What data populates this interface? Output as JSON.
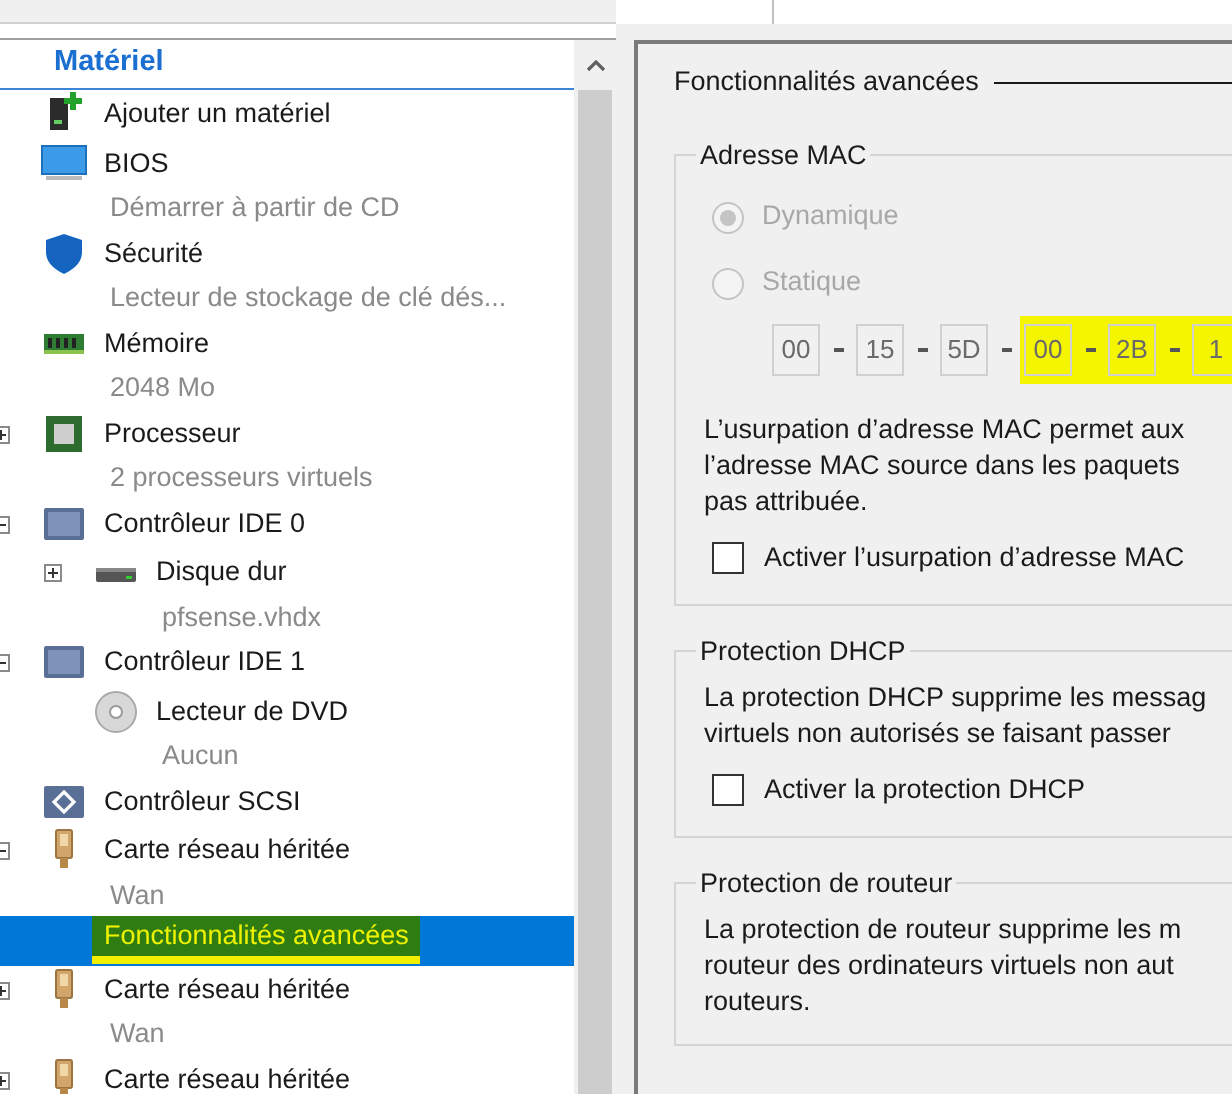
{
  "sidebar": {
    "header": "Matériel",
    "items": [
      {
        "kind": "add-hardware",
        "label": "Ajouter un matériel",
        "selected": false
      },
      {
        "kind": "bios",
        "label": "BIOS",
        "detail": "Démarrer à partir de CD",
        "selected": false
      },
      {
        "kind": "security",
        "label": "Sécurité",
        "detail": "Lecteur de stockage de clé dés...",
        "selected": false
      },
      {
        "kind": "memory",
        "label": "Mémoire",
        "detail": "2048 Mo",
        "selected": false
      },
      {
        "kind": "processor",
        "label": "Processeur",
        "detail": "2 processeurs virtuels",
        "expanded": false,
        "selected": false
      },
      {
        "kind": "ide",
        "label": "Contrôleur IDE 0",
        "expanded": true,
        "selected": false,
        "children": [
          {
            "kind": "disk",
            "label": "Disque dur",
            "detail": "pfsense.vhdx",
            "expanded": false,
            "selected": false
          }
        ]
      },
      {
        "kind": "ide",
        "label": "Contrôleur IDE 1",
        "expanded": true,
        "selected": false,
        "children": [
          {
            "kind": "dvd",
            "label": "Lecteur de DVD",
            "detail": "Aucun",
            "selected": false
          }
        ]
      },
      {
        "kind": "scsi",
        "label": "Contrôleur SCSI",
        "selected": false
      },
      {
        "kind": "network",
        "label": "Carte réseau héritée",
        "detail": "Wan",
        "expanded": true,
        "selected": false,
        "children": [
          {
            "kind": "feature",
            "label": "Fonctionnalités avancées",
            "selected": true,
            "highlighted": true
          }
        ]
      },
      {
        "kind": "network",
        "label": "Carte réseau héritée",
        "detail": "Wan",
        "expanded": false,
        "selected": false
      },
      {
        "kind": "network",
        "label": "Carte réseau héritée",
        "expanded": false,
        "selected": false
      }
    ]
  },
  "settings": {
    "title": "Fonctionnalités avancées",
    "groups": [
      {
        "kind": "mac",
        "title": "Adresse MAC",
        "radios": [
          {
            "label": "Dynamique",
            "selected": true,
            "disabled": true
          },
          {
            "label": "Statique",
            "selected": false,
            "disabled": true
          }
        ],
        "mac_fields": [
          {
            "value": "00",
            "highlighted": false
          },
          {
            "value": "15",
            "highlighted": false
          },
          {
            "value": "5D",
            "highlighted": false
          },
          {
            "value": "00",
            "highlighted": true
          },
          {
            "value": "2B",
            "highlighted": true
          },
          {
            "value": "1",
            "highlighted": true
          }
        ],
        "description_lines": [
          "L’usurpation d’adresse MAC permet aux",
          "l’adresse MAC source dans les paquets",
          "pas attribuée."
        ],
        "checkbox": {
          "label": "Activer l’usurpation d’adresse MAC",
          "checked": false
        }
      },
      {
        "kind": "dhcp",
        "title": "Protection DHCP",
        "description_lines": [
          "La protection DHCP supprime les messag",
          "virtuels non autorisés se faisant passer"
        ],
        "checkbox": {
          "label": "Activer la protection DHCP",
          "checked": false
        }
      },
      {
        "kind": "router",
        "title": "Protection de routeur",
        "description_lines": [
          "La protection de routeur supprime les m",
          "routeur des ordinateurs virtuels non aut",
          "routeurs."
        ]
      }
    ]
  }
}
